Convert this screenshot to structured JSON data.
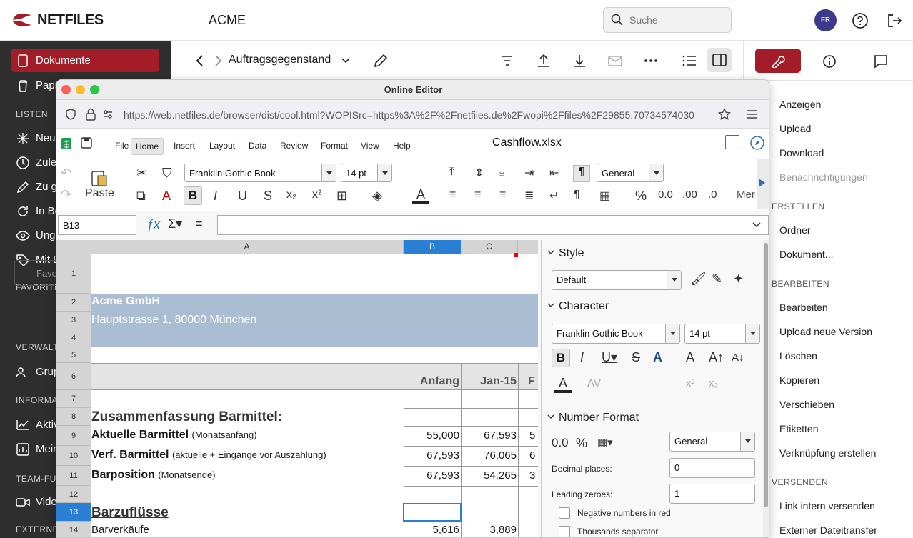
{
  "app": {
    "brand": "NETFILES",
    "org": "ACME",
    "search_placeholder": "Suche",
    "avatar": "FR"
  },
  "sidebar": {
    "items": [
      "Dokumente",
      "Papi",
      "Neu",
      "Zule",
      "Zu g",
      "In Be",
      "Ung",
      "Mit E",
      "Grup",
      "Aktiv",
      "Mein",
      "Vide"
    ],
    "heads": [
      "LISTEN",
      "FAVORITE",
      "VERWALT",
      "INFORMA",
      "TEAM-FU",
      "EXTERNE"
    ],
    "fav_placeholder": "Favo"
  },
  "crumb": {
    "title": "Auftragsgegenstand"
  },
  "rightpanel": {
    "items1": [
      "Anzeigen",
      "Upload",
      "Download",
      "Benachrichtigungen"
    ],
    "head1": "ERSTELLEN",
    "items2": [
      "Ordner",
      "Dokument..."
    ],
    "head2": "BEARBEITEN",
    "items3": [
      "Bearbeiten",
      "Upload neue Version",
      "Löschen",
      "Kopieren",
      "Verschieben",
      "Etiketten",
      "Verknüpfung erstellen"
    ],
    "head3": "VERSENDEN",
    "items4": [
      "Link intern versenden",
      "Externer Dateitransfer"
    ]
  },
  "editor": {
    "window_title": "Online Editor",
    "url": "https://web.netfiles.de/browser/dist/cool.html?WOPISrc=https%3A%2F%2Fnetfiles.de%2Fwopi%2Ffiles%2F29855.70734574030",
    "menus": [
      "File",
      "Home",
      "Insert",
      "Layout",
      "Data",
      "Review",
      "Format",
      "View",
      "Help"
    ],
    "filename": "Cashflow.xlsx",
    "font": "Franklin Gothic Book",
    "size": "14 pt",
    "numfmt": "General",
    "paste": "Paste",
    "more": "Mer",
    "namebox": "B13"
  },
  "sheet": {
    "cols": [
      "A",
      "B",
      "C"
    ],
    "rows": [
      "1",
      "2",
      "3",
      "4",
      "5",
      "6",
      "7",
      "8",
      "9",
      "10",
      "11",
      "12",
      "13",
      "14"
    ],
    "company": "Acme GmbH",
    "address": "Hauptstrasse 1, 80000 München",
    "h_anfang": "Anfang",
    "h_jan": "Jan-15",
    "h_f": "F",
    "r8": "Zusammenfassung Barmittel:",
    "r9a": "Aktuelle Barmittel",
    "r9b": "(Monatsanfang)",
    "r9v": [
      "55,000",
      "67,593",
      "5"
    ],
    "r10a": "Verf. Barmittel",
    "r10b": "(aktuelle + Eingänge vor Auszahlung)",
    "r10v": [
      "67,593",
      "76,065",
      "6"
    ],
    "r11a": "Barposition",
    "r11b": "(Monatsende)",
    "r11v": [
      "67,593",
      "54,265",
      "3"
    ],
    "r13": "Barzuflüsse",
    "r14": "Barverkäufe",
    "r14v": [
      "5,616",
      "3,889"
    ]
  },
  "sidepanel": {
    "style": "Style",
    "style_val": "Default",
    "character": "Character",
    "font": "Franklin Gothic Book",
    "size": "14 pt",
    "numformat": "Number Format",
    "numfmt_val": "General",
    "decimal_label": "Decimal places:",
    "decimal_val": "0",
    "leading_label": "Leading zeroes:",
    "leading_val": "1",
    "neg_red": "Negative numbers in red",
    "thousands": "Thousands separator"
  }
}
